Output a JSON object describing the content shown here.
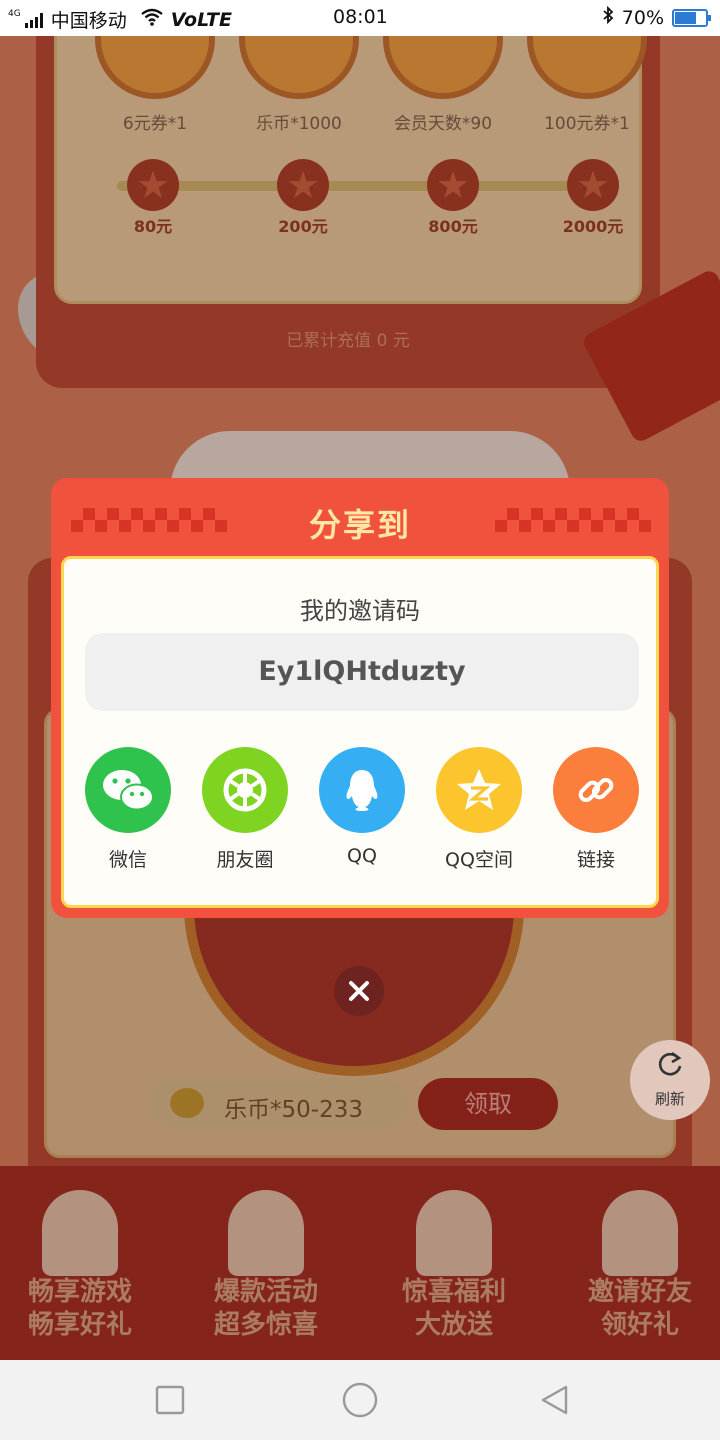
{
  "status_bar": {
    "network": "4G",
    "carrier": "中国移动",
    "volte": "VoLTE",
    "time": "08:01",
    "battery": "70%"
  },
  "prizes": [
    {
      "label": "6元券*1"
    },
    {
      "label": "乐币*1000"
    },
    {
      "label": "会员天数*90"
    },
    {
      "label": "100元券*1"
    }
  ],
  "milestones": [
    "80元",
    "200元",
    "800元",
    "2000元"
  ],
  "recharge_text": "已累计充值 0 元",
  "lottery": {
    "coin_text": "乐币*50-233",
    "claim_label": "领取"
  },
  "refresh_label": "刷新",
  "banners": [
    {
      "line1": "畅享游戏",
      "line2": "畅享好礼"
    },
    {
      "line1": "爆款活动",
      "line2": "超多惊喜"
    },
    {
      "line1": "惊喜福利",
      "line2": "大放送"
    },
    {
      "line1": "邀请好友",
      "line2": "领好礼"
    }
  ],
  "share_dialog": {
    "title": "分享到",
    "subtitle": "我的邀请码",
    "invite_code": "Ey1lQHtduzty",
    "options": [
      {
        "label": "微信",
        "icon": "wechat-icon",
        "color": "#2fc34d"
      },
      {
        "label": "朋友圈",
        "icon": "moments-icon",
        "color": "#7fd321"
      },
      {
        "label": "QQ",
        "icon": "qq-icon",
        "color": "#35aef4"
      },
      {
        "label": "QQ空间",
        "icon": "qzone-icon",
        "color": "#fcc52d"
      },
      {
        "label": "链接",
        "icon": "link-icon",
        "color": "#fb7e3c"
      }
    ]
  },
  "close_icon": "close-icon",
  "colors": {
    "dialog_bg": "#f0523d",
    "card_border": "#ffd64f",
    "title": "#ffe7a6"
  }
}
